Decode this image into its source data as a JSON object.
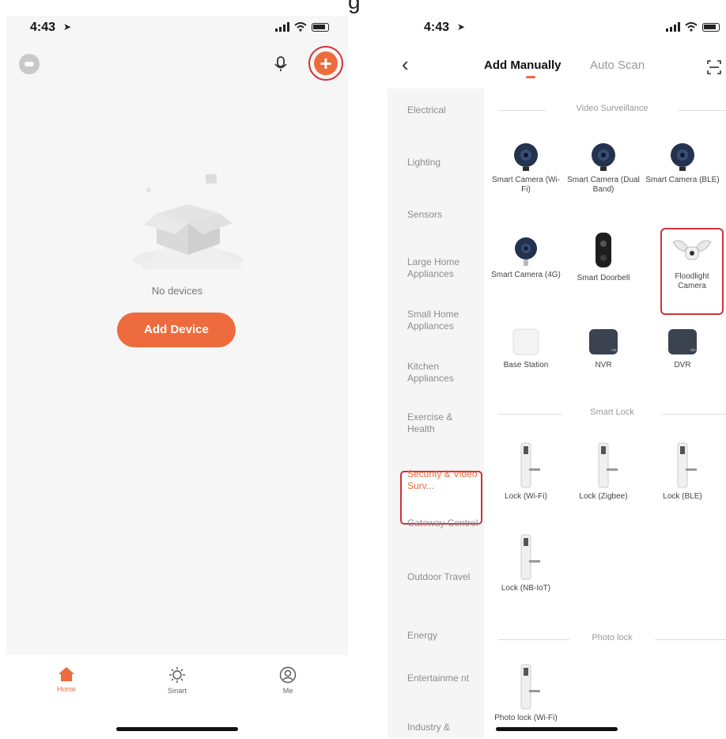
{
  "header_partial": "g",
  "screen1": {
    "status_time": "4:43",
    "empty_text": "No devices",
    "add_button": "Add Device",
    "tabs": [
      {
        "label": "Home",
        "icon": "home-icon",
        "active": true
      },
      {
        "label": "Smart",
        "icon": "sun-icon",
        "active": false
      },
      {
        "label": "Me",
        "icon": "profile-icon",
        "active": false
      }
    ],
    "colors": {
      "accent": "#ed6b3c",
      "highlight": "#d0323a"
    }
  },
  "screen2": {
    "status_time": "4:43",
    "tabs": {
      "manual": "Add Manually",
      "scan": "Auto Scan"
    },
    "categories": [
      {
        "label": "Electrical"
      },
      {
        "label": "Lighting"
      },
      {
        "label": "Sensors"
      },
      {
        "label": "Large Home Appliances"
      },
      {
        "label": "Small Home Appliances"
      },
      {
        "label": "Kitchen Appliances"
      },
      {
        "label": "Exercise & Health"
      },
      {
        "label": "Security & Video Surv..."
      },
      {
        "label": "Gateway Control"
      },
      {
        "label": "Outdoor Travel"
      },
      {
        "label": "Energy"
      },
      {
        "label": "Entertainme nt"
      },
      {
        "label": "Industry &"
      }
    ],
    "sections": [
      {
        "title": "Video Surveillance"
      },
      {
        "title": "Smart Lock"
      },
      {
        "title": "Photo lock"
      }
    ],
    "devices": [
      {
        "label": "Smart Camera (Wi-Fi)"
      },
      {
        "label": "Smart Camera (Dual Band)"
      },
      {
        "label": "Smart Camera (BLE)"
      },
      {
        "label": "Smart Camera (4G)"
      },
      {
        "label": "Smart Doorbell"
      },
      {
        "label": "Floodlight Camera"
      },
      {
        "label": "Base Station"
      },
      {
        "label": "NVR"
      },
      {
        "label": "DVR"
      },
      {
        "label": "Lock (Wi-Fi)"
      },
      {
        "label": "Lock (Zigbee)"
      },
      {
        "label": "Lock (BLE)"
      },
      {
        "label": "Lock (NB-IoT)"
      },
      {
        "label": "Photo lock (Wi-Fi)"
      }
    ]
  }
}
